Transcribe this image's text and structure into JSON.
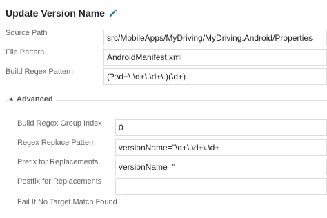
{
  "header": {
    "title": "Update Version Name",
    "edit_icon": "pencil-icon"
  },
  "fields": {
    "source_path": {
      "label": "Source Path",
      "value": "src/MobileApps/MyDriving/MyDriving.Android/Properties"
    },
    "file_pattern": {
      "label": "File Pattern",
      "value": "AndroidManifest.xml"
    },
    "build_regex_pattern": {
      "label": "Build Regex Pattern",
      "value": "(?:\\d+\\.\\d+\\.\\d+\\.)(\\d+)"
    }
  },
  "advanced": {
    "label": "Advanced",
    "toggle_icon": "collapse-arrow-icon",
    "build_regex_group_index": {
      "label": "Build Regex Group Index",
      "value": "0"
    },
    "regex_replace_pattern": {
      "label": "Regex Replace Pattern",
      "value": "versionName=\"\\d+\\.\\d+\\.\\d+"
    },
    "prefix_for_replacements": {
      "label": "Prefix for Replacements",
      "value": "versionName=\""
    },
    "postfix_for_replacements": {
      "label": "Postfix for Replacements",
      "value": ""
    },
    "fail_if_no_target_match_found": {
      "label": "Fail If No Target Match Found",
      "checked": false
    }
  },
  "colors": {
    "accent": "#2e73b8",
    "border": "#dddddd",
    "label_text": "#666666"
  }
}
